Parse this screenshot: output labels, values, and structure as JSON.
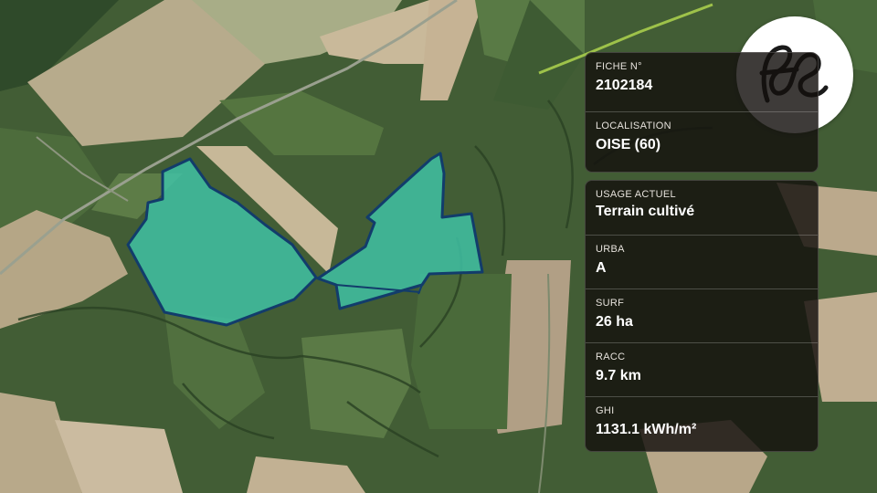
{
  "map": {
    "parcel_fill": "#3fc4a8",
    "parcel_stroke": "#123c6b"
  },
  "logo": {
    "icon": "fs-monogram-logo"
  },
  "fiche": {
    "number_label": "FICHE N°",
    "number_value": "2102184",
    "localisation_label": "LOCALISATION",
    "localisation_value": "OISE (60)"
  },
  "details": {
    "usage_label": "USAGE ACTUEL",
    "usage_value": "Terrain cultivé",
    "urba_label": "URBA",
    "urba_value": "A",
    "surf_label": "SURF",
    "surf_value": "26 ha",
    "racc_label": "RACC",
    "racc_value": "9.7 km",
    "ghi_label": "GHI",
    "ghi_value": "1131.1 kWh/m²"
  }
}
